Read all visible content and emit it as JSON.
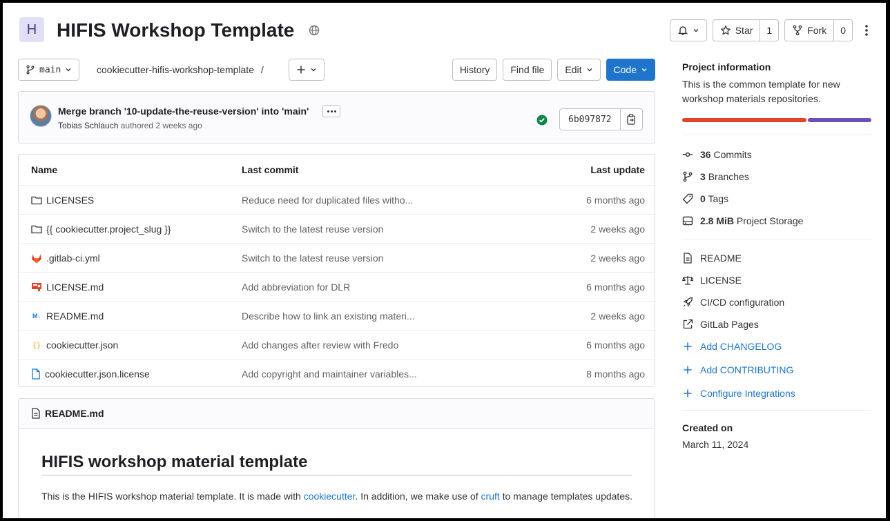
{
  "header": {
    "avatar_letter": "H",
    "title": "HIFIS Workshop Template",
    "star_label": "Star",
    "star_count": "1",
    "fork_label": "Fork",
    "fork_count": "0"
  },
  "toolbar": {
    "branch": "main",
    "repo_path": "cookiecutter-hifis-workshop-template",
    "path_sep": "/",
    "history_label": "History",
    "find_file_label": "Find file",
    "edit_label": "Edit",
    "code_label": "Code"
  },
  "commit": {
    "title": "Merge branch '10-update-the-reuse-version' into 'main'",
    "author": "Tobias Schlauch",
    "meta": "authored 2 weeks ago",
    "sha": "6b097872"
  },
  "file_table": {
    "headers": [
      "Name",
      "Last commit",
      "Last update"
    ],
    "rows": [
      {
        "name": "LICENSES",
        "icon": "folder-icon",
        "commit": "Reduce need for duplicated files witho...",
        "updated": "6 months ago"
      },
      {
        "name": "{{ cookiecutter.project_slug }}",
        "icon": "folder-icon",
        "commit": "Switch to the latest reuse version",
        "updated": "2 weeks ago"
      },
      {
        "name": ".gitlab-ci.yml",
        "icon": "gitlab-icon",
        "commit": "Switch to the latest reuse version",
        "updated": "2 weeks ago"
      },
      {
        "name": "LICENSE.md",
        "icon": "license-file-icon",
        "commit": "Add abbreviation for DLR",
        "updated": "6 months ago"
      },
      {
        "name": "README.md",
        "icon": "markdown-icon",
        "commit": "Describe how to link an existing materi...",
        "updated": "2 weeks ago"
      },
      {
        "name": "cookiecutter.json",
        "icon": "json-icon",
        "commit": "Add changes after review with Fredo",
        "updated": "6 months ago"
      },
      {
        "name": "cookiecutter.json.license",
        "icon": "file-icon",
        "commit": "Add copyright and maintainer variables...",
        "updated": "8 months ago"
      }
    ]
  },
  "readme": {
    "filename": "README.md",
    "heading": "HIFIS workshop material template",
    "p_part1": "This is the HIFIS workshop material template. It is made with ",
    "link1": "cookiecutter",
    "p_part2": ". In addition, we make use of ",
    "link2": "cruft",
    "p_part3": " to manage templates updates."
  },
  "sidebar": {
    "title": "Project information",
    "description": "This is the common template for new workshop materials repositories.",
    "language_colors": [
      "#e24329",
      "#6b4fbb"
    ],
    "language_shares": [
      0.66,
      0.34
    ],
    "stats": [
      {
        "count": "36",
        "label": "Commits",
        "icon": "commit-icon"
      },
      {
        "count": "3",
        "label": "Branches",
        "icon": "branch-icon"
      },
      {
        "count": "0",
        "label": "Tags",
        "icon": "tag-icon"
      },
      {
        "count": "2.8 MiB",
        "label": "Project Storage",
        "icon": "storage-icon"
      }
    ],
    "links": [
      {
        "label": "README",
        "icon": "readme-icon"
      },
      {
        "label": "LICENSE",
        "icon": "scale-icon"
      },
      {
        "label": "CI/CD configuration",
        "icon": "rocket-icon"
      },
      {
        "label": "GitLab Pages",
        "icon": "external-link-icon"
      }
    ],
    "add_links": [
      "Add CHANGELOG",
      "Add CONTRIBUTING",
      "Configure Integrations"
    ],
    "created_label": "Created on",
    "created_date": "March 11, 2024"
  },
  "colors": {
    "primary": "#1f75cb",
    "success": "#108548"
  }
}
